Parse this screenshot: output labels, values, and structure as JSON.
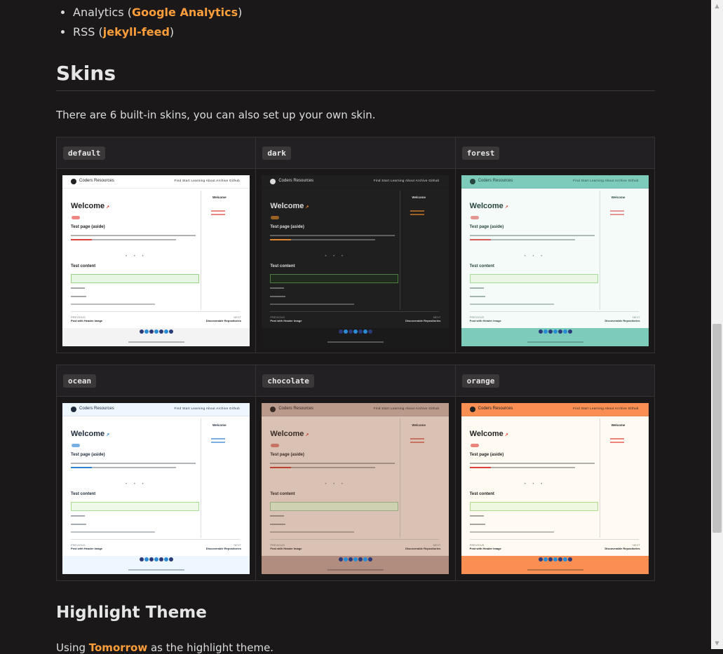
{
  "features": [
    {
      "label": "Analytics (",
      "link": "Google Analytics",
      "suffix": ")"
    },
    {
      "label": "RSS (",
      "link": "jekyll-feed",
      "suffix": ")"
    }
  ],
  "skins_heading": "Skins",
  "skins_intro": "There are 6 built-in skins, you can also set up your own skin.",
  "skins": [
    {
      "name": "default",
      "bg": "#ffffff",
      "nav": "#ffffff",
      "text": "#222222",
      "accent": "#e0352b",
      "foot": "#f3f3f3",
      "box": "#e6f6e2",
      "boxborder": "#9ad38b"
    },
    {
      "name": "dark",
      "bg": "#1f1f1f",
      "nav": "#1f1f1f",
      "text": "#dddddd",
      "accent": "#f08c2a",
      "foot": "#1a1a1a",
      "box": "#1f2b1c",
      "boxborder": "#4d7d40"
    },
    {
      "name": "forest",
      "bg": "#f4fbf8",
      "nav": "#7dcbbb",
      "text": "#27453e",
      "accent": "#d9534f",
      "foot": "#7dcbbb",
      "box": "#eaf7e4",
      "boxborder": "#a6d99a"
    },
    {
      "name": "ocean",
      "bg": "#ffffff",
      "nav": "#eef6ff",
      "text": "#1e2b3a",
      "accent": "#1f7cd1",
      "foot": "#eef6ff",
      "box": "#eef9e8",
      "boxborder": "#a9dd97"
    },
    {
      "name": "chocolate",
      "bg": "#d9c2b4",
      "nav": "#b99a8b",
      "text": "#3a2a24",
      "accent": "#bb3a2a",
      "foot": "#b08d7e",
      "box": "#cfd2b2",
      "boxborder": "#9aa981"
    },
    {
      "name": "orange",
      "bg": "#fffbf2",
      "nav": "#f98f52",
      "text": "#222222",
      "accent": "#e0352b",
      "foot": "#f98f52",
      "box": "#eef7df",
      "boxborder": "#b1d98d"
    }
  ],
  "thumb_text": {
    "site": "Coders Resources",
    "menu": "Find  Start  Learning  About  Archive  Github",
    "welcome": "Welcome",
    "aside_title": "Welcome",
    "test_page": "Test page (aside)",
    "test_content": "Test content",
    "prev_label": "PREVIOUS",
    "prev_title": "Post with Header Image",
    "next_label": "NEXT",
    "next_title": "Discoverable Repositories"
  },
  "highlight_heading": "Highlight Theme",
  "highlight_text": {
    "before": "Using ",
    "link": "Tomorrow",
    "after": " as the highlight theme."
  },
  "scrollbar": {
    "up_icon": "arrow-up",
    "down_icon": "arrow-down"
  }
}
